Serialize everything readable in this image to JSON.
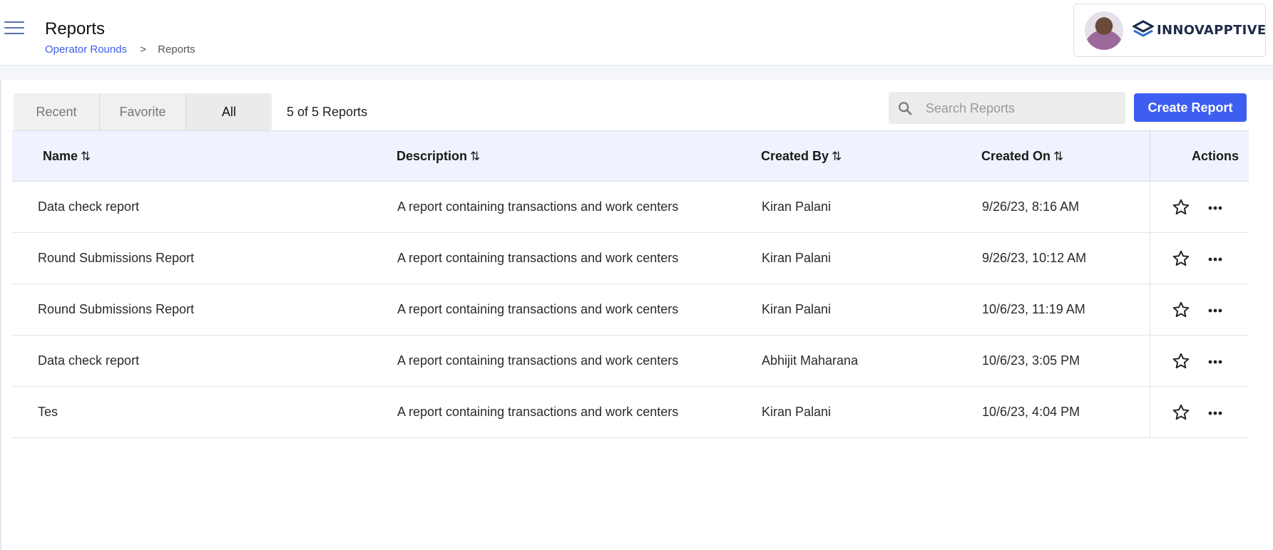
{
  "header": {
    "title": "Reports",
    "breadcrumb": {
      "link": "Operator Rounds",
      "separator": ">",
      "current": "Reports"
    },
    "brand": "INNOVAPPTIVE",
    "menu_icon": "hamburger-menu-icon"
  },
  "toolbar": {
    "tabs": [
      {
        "label": "Recent",
        "active": false
      },
      {
        "label": "Favorite",
        "active": false
      },
      {
        "label": "All",
        "active": true
      }
    ],
    "count_text": "5 of 5 Reports",
    "search_placeholder": "Search Reports",
    "create_label": "Create Report"
  },
  "table": {
    "columns": [
      "Name",
      "Description",
      "Created By",
      "Created On",
      "Actions"
    ],
    "sort_icon": "⇅",
    "rows": [
      {
        "name": "Data check report",
        "description": "A report containing transactions and work centers",
        "created_by": "Kiran Palani",
        "created_on": "9/26/23, 8:16 AM"
      },
      {
        "name": "Round Submissions Report",
        "description": "A report containing transactions and work centers",
        "created_by": "Kiran Palani",
        "created_on": "9/26/23, 10:12 AM"
      },
      {
        "name": "Round Submissions Report",
        "description": "A report containing transactions and work centers",
        "created_by": "Kiran Palani",
        "created_on": "10/6/23, 11:19 AM"
      },
      {
        "name": "Data check report",
        "description": "A report containing transactions and work centers",
        "created_by": "Abhijit Maharana",
        "created_on": "10/6/23, 3:05 PM"
      },
      {
        "name": "Tes",
        "description": "A report containing transactions and work centers",
        "created_by": "Kiran Palani",
        "created_on": "10/6/23, 4:04 PM"
      }
    ]
  },
  "colors": {
    "accent": "#3d5ef0",
    "link": "#3c5ee6",
    "header_bg": "#eef3fd"
  }
}
